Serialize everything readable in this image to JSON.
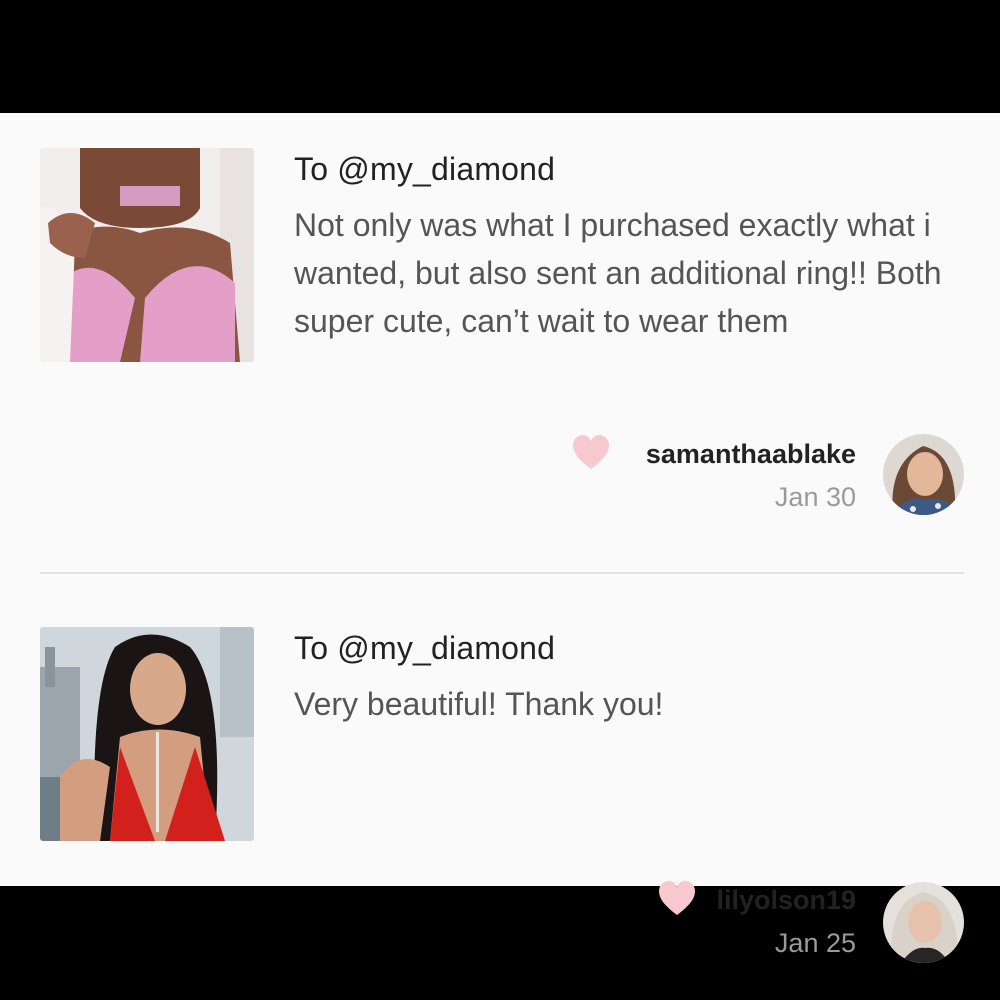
{
  "reviews": [
    {
      "recipient": "To @my_diamond",
      "text": "Not only was what I purchased exactly what i wanted, but also sent an additional ring!! Both super cute, can’t wait to wear them",
      "username": "samanthaablake",
      "date": "Jan 30",
      "icon": "heart-icon"
    },
    {
      "recipient": "To @my_diamond",
      "text": "Very beautiful! Thank you!",
      "username": "lilyolson19",
      "date": "Jan 25",
      "icon": "heart-icon"
    }
  ],
  "colors": {
    "heart": "#f7c9cf",
    "background": "#fafafa",
    "letterbox": "#000000"
  }
}
